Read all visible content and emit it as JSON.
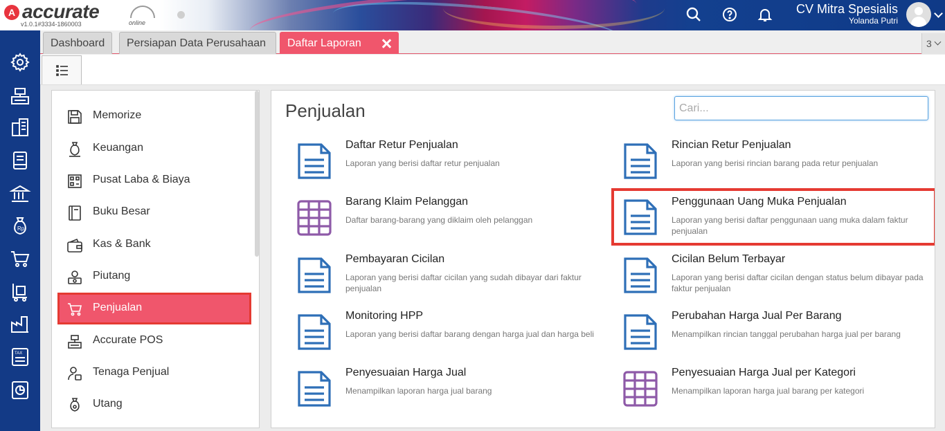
{
  "app": {
    "logo_text": "accurate",
    "logo_sub": "online",
    "version": "v1.0.1#3334-1860003",
    "company": "CV Mitra Spesialis",
    "user": "Yolanda Putri"
  },
  "tabs": [
    {
      "label": "Dashboard"
    },
    {
      "label": "Persiapan Data Perusahaan"
    },
    {
      "label": "Daftar Laporan",
      "active": true
    }
  ],
  "tab_count": "3",
  "rail_icons": [
    "gear-icon",
    "cashier-icon",
    "building-icon",
    "book-icon",
    "bank-icon",
    "money-bag-icon",
    "cart-icon",
    "trolley-icon",
    "factory-icon",
    "tax-icon",
    "chart-icon"
  ],
  "sidebar": {
    "items": [
      {
        "label": "Memorize",
        "icon": "floppy-disk-icon"
      },
      {
        "label": "Keuangan",
        "icon": "money-bag-icon"
      },
      {
        "label": "Pusat Laba & Biaya",
        "icon": "building-grid-icon"
      },
      {
        "label": "Buku Besar",
        "icon": "ledger-book-icon"
      },
      {
        "label": "Kas & Bank",
        "icon": "wallet-icon"
      },
      {
        "label": "Piutang",
        "icon": "receivable-icon"
      },
      {
        "label": "Penjualan",
        "icon": "cart-icon",
        "selected": true
      },
      {
        "label": "Accurate POS",
        "icon": "pos-icon"
      },
      {
        "label": "Tenaga Penjual",
        "icon": "salesperson-icon"
      },
      {
        "label": "Utang",
        "icon": "payable-bag-icon"
      }
    ]
  },
  "main": {
    "title": "Penjualan",
    "search_placeholder": "Cari...",
    "reports": [
      {
        "title": "Daftar Retur Penjualan",
        "desc": "Laporan yang berisi daftar retur penjualan",
        "icon": "document-icon"
      },
      {
        "title": "Rincian Retur Penjualan",
        "desc": "Laporan yang berisi rincian barang pada retur penjualan",
        "icon": "document-icon"
      },
      {
        "title": "Barang Klaim Pelanggan",
        "desc": "Daftar barang-barang yang diklaim oleh pelanggan",
        "icon": "grid-table-icon"
      },
      {
        "title": "Penggunaan Uang Muka Penjualan",
        "desc": "Laporan yang berisi daftar penggunaan uang muka dalam faktur penjualan",
        "icon": "document-icon",
        "highlighted": true
      },
      {
        "title": "Pembayaran Cicilan",
        "desc": "Laporan yang berisi daftar cicilan yang sudah dibayar dari faktur penjualan",
        "icon": "document-icon"
      },
      {
        "title": "Cicilan Belum Terbayar",
        "desc": "Laporan yang berisi daftar cicilan dengan status belum dibayar pada faktur penjualan",
        "icon": "document-icon"
      },
      {
        "title": "Monitoring HPP",
        "desc": "Laporan yang berisi daftar barang dengan harga jual dan harga beli",
        "icon": "document-icon"
      },
      {
        "title": "Perubahan Harga Jual Per Barang",
        "desc": "Menampilkan rincian tanggal perubahan harga jual per barang",
        "icon": "document-icon"
      },
      {
        "title": "Penyesuaian Harga Jual",
        "desc": "Menampilkan laporan harga jual barang",
        "icon": "document-icon"
      },
      {
        "title": "Penyesuaian Harga Jual per Kategori",
        "desc": "Menampilkan laporan harga jual barang per kategori",
        "icon": "grid-table-icon"
      }
    ]
  },
  "colors": {
    "accent_pink": "#f0566c",
    "highlight_red": "#e53a32",
    "rail_blue": "#133a86",
    "doc_icon_blue": "#2e6fb7",
    "grid_icon_purple": "#8e5aa8"
  }
}
